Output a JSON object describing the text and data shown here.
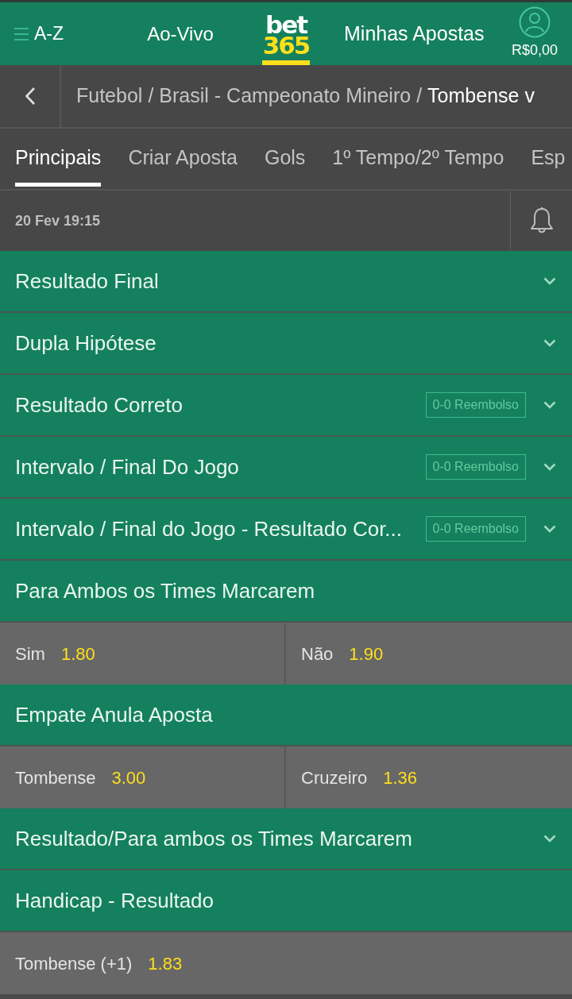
{
  "header": {
    "menu_label": "A-Z",
    "live_link": "Ao-Vivo",
    "logo": {
      "line_1": "bet",
      "line_2": "365"
    },
    "bets_link": "Minhas Apostas",
    "balance": "R$0,00"
  },
  "breadcrumb": {
    "separator": "/",
    "items": [
      {
        "label": "Futebol",
        "selected": false
      },
      {
        "label": "Brasil - Campeonato Mineiro",
        "selected": false
      },
      {
        "label": "Tombense v",
        "selected": true
      }
    ]
  },
  "tabs": [
    {
      "label": "Principais",
      "selected": true
    },
    {
      "label": "Criar Aposta",
      "selected": false
    },
    {
      "label": "Gols",
      "selected": false
    },
    {
      "label": "1º Tempo/2º Tempo",
      "selected": false
    },
    {
      "label": "Esp",
      "selected": false
    }
  ],
  "event": {
    "date": "20 Fev 19:15"
  },
  "markets": [
    {
      "title": "Resultado Final",
      "expanded": false
    },
    {
      "title": "Dupla Hipótese",
      "expanded": false
    },
    {
      "title": "Resultado Correto",
      "badge": "0-0 Reembolso",
      "expanded": false
    },
    {
      "title": "Intervalo / Final Do Jogo",
      "badge": "0-0 Reembolso",
      "expanded": false
    },
    {
      "title": "Intervalo / Final do Jogo - Resultado Cor...",
      "badge": "0-0 Reembolso",
      "expanded": false
    },
    {
      "title": "Para Ambos os Times Marcarem",
      "expanded": true,
      "selections": [
        {
          "label": "Sim",
          "odds": "1.80"
        },
        {
          "label": "Não",
          "odds": "1.90"
        }
      ]
    },
    {
      "title": "Empate Anula Aposta",
      "expanded": true,
      "selections": [
        {
          "label": "Tombense",
          "odds": "3.00"
        },
        {
          "label": "Cruzeiro",
          "odds": "1.36"
        }
      ]
    },
    {
      "title": "Resultado/Para ambos os Times Marcarem",
      "expanded": false
    },
    {
      "title": "Handicap - Resultado",
      "expanded": true,
      "selections": [
        {
          "label": "Tombense (+1)",
          "odds": "1.83"
        }
      ]
    }
  ]
}
